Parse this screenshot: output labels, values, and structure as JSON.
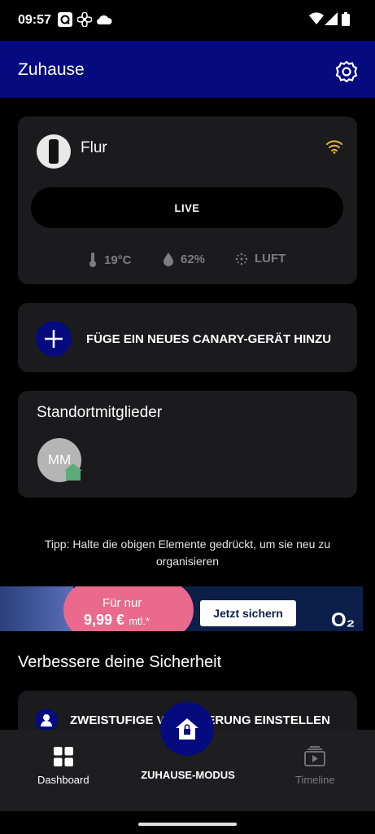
{
  "status_bar": {
    "time": "09:57",
    "left_icons": [
      "q-app-icon",
      "fan-icon",
      "cloud-icon"
    ],
    "right_icons": [
      "wifi-icon",
      "signal-icon",
      "battery-icon"
    ]
  },
  "app_bar": {
    "title": "Zuhause",
    "settings_icon": "gear-icon"
  },
  "device_card": {
    "name": "Flur",
    "live_label": "LIVE",
    "temperature": "19°C",
    "humidity": "62%",
    "air": "LUFT",
    "wifi_color": "#e2b33c"
  },
  "add_device": {
    "label": "FÜGE EIN NEUES CANARY-GERÄT HINZU"
  },
  "members": {
    "title": "Standortmitglieder",
    "items": [
      {
        "initials": "MM",
        "badge_icon": "home-icon",
        "badge_color": "#5dab7a"
      }
    ]
  },
  "tip": "Tipp: Halte die obigen Elemente gedrückt, um sie neu zu organisieren",
  "ad": {
    "pre_price": "Für nur",
    "price": "9,99 €",
    "price_unit": "mtl.*",
    "cta": "Jetzt sichern",
    "brand": "O₂"
  },
  "security": {
    "title": "Verbessere deine Sicherheit",
    "two_factor_label": "ZWEISTUFIGE VERIFIZIERUNG EINSTELLEN"
  },
  "bottom_nav": {
    "dashboard": "Dashboard",
    "home_mode": "ZUHAUSE-MODUS",
    "timeline": "Timeline"
  },
  "colors": {
    "brand_blue": "#050a7e",
    "card_bg": "#1b1b1d",
    "muted_text": "#7d7d80"
  }
}
